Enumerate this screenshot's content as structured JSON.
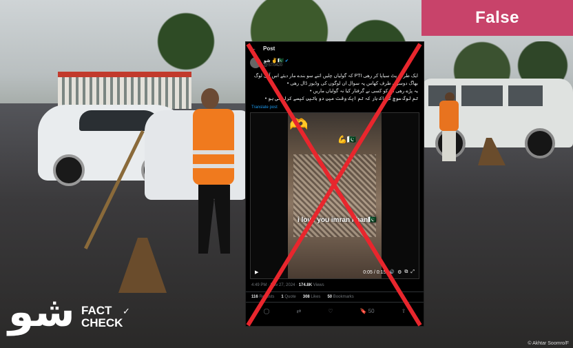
{
  "verdict": {
    "label": "False",
    "color": "#c8436a"
  },
  "tweet": {
    "header": "Post",
    "display_name": "شو ✌🇵🇰",
    "handle": "@ST0420",
    "text_line1": "ایک طرف پٹ سیاپا کر رهی PTI کہ گولیاں چلیں اتنے سو بندے مار دیئے اس آئی لوگ",
    "text_line2": "بھاگ دوسری طرف کھاس پہ سوال ان لوگوں کی وڈیوز ڈال رهی •",
    "text_line3": "یہ پڑے رهی ان کو کسی نے گرفتار کیا نہ گولیاں ماریں •",
    "text_line4": "تم لوگ سوچ کے اک بار کہ تم ایک وقت میں دو باتیں کیسے کرلیتی ہو •",
    "translate": "Translate post",
    "video_caption": "i love you imran khan🇵🇰",
    "video_time": "0:05 / 0:15",
    "posted_time": "4:49 PM · Nov 27, 2024 · ",
    "views_count": "174.8K",
    "views_label": " Views",
    "stats": [
      {
        "count": "116",
        "label": " Reposts"
      },
      {
        "count": "1",
        "label": " Quote"
      },
      {
        "count": "308",
        "label": " Likes"
      },
      {
        "count": "50",
        "label": " Bookmarks"
      }
    ],
    "bookmark_count": "50"
  },
  "logo": {
    "fact": "FACT",
    "check": "CHECK"
  },
  "credit": "© Akhtar Soomro/F"
}
